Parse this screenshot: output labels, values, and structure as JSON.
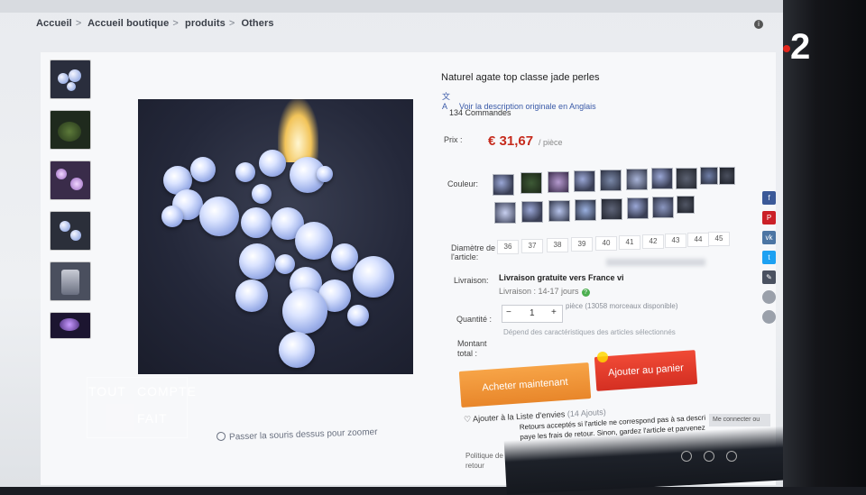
{
  "breadcrumb": [
    "Accueil",
    "Accueil boutique",
    "produits",
    "Others"
  ],
  "product": {
    "title": "Naturel agate top classe jade perles",
    "translate_link": "Voir la description originale en Anglais",
    "orders": "134 Commandes",
    "price_label": "Prix :",
    "price_value": "€ 31,67",
    "price_unit": "/ pièce",
    "color_label": "Couleur:",
    "diameter_label": "Diamètre de l'article:",
    "sizes": [
      "36",
      "37",
      "38",
      "39",
      "40",
      "41",
      "42",
      "43",
      "44",
      "45"
    ],
    "delivery_label": "Livraison:",
    "delivery_value": "Livraison gratuite vers France vi",
    "delivery_days": "Livraison : 14-17 jours",
    "quantity_label": "Quantité :",
    "quantity_minus": "−",
    "quantity_value": "1",
    "quantity_plus": "+",
    "quantity_note": "pièce (13058 morceaux disponible)",
    "total_label": "Montant total :",
    "total_value": "Dépend des caractéristiques des articles sélectionnés",
    "buy_now": "Acheter maintenant",
    "add_to_cart": "Ajouter au panier",
    "wishlist": "Ajouter à la Liste d'envies",
    "wishlist_count": "(14 Ajouts)",
    "return_label": "Politique de retour",
    "return_text_1": "Retours acceptés si l'article ne correspond pas à sa descri",
    "return_text_2": "paye les frais de retour. Sinon, gardez l'article et parvenez"
  },
  "image": {
    "zoom_hint": "Passer la souris dessus pour zoomer"
  },
  "overlay": {
    "tcf_line1": "TOUT",
    "tcf_line2": "COMPTE",
    "tcf_line3": "FAIT",
    "channel": "2"
  },
  "popup_text": "Me connecter ou",
  "colors": {
    "price": "#c62b1d",
    "buy_button": "#f39b3f",
    "cart_button": "#e2402f",
    "channel_dot": "#e3261c"
  },
  "icons": [
    "info-icon",
    "translate-icon",
    "help-icon",
    "zoom-icon",
    "heart-icon",
    "facebook-icon",
    "pinterest-icon",
    "vk-icon",
    "twitter-icon",
    "edit-icon"
  ]
}
